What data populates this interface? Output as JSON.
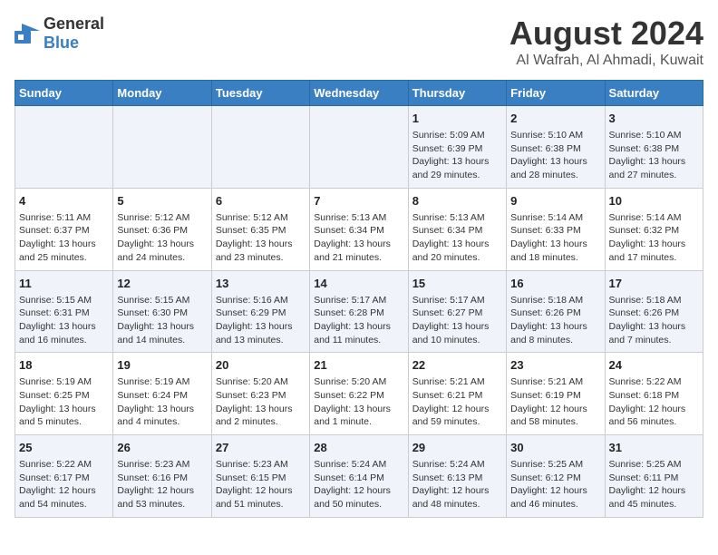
{
  "logo": {
    "general": "General",
    "blue": "Blue"
  },
  "title": "August 2024",
  "subtitle": "Al Wafrah, Al Ahmadi, Kuwait",
  "days_of_week": [
    "Sunday",
    "Monday",
    "Tuesday",
    "Wednesday",
    "Thursday",
    "Friday",
    "Saturday"
  ],
  "weeks": [
    [
      {
        "num": "",
        "content": ""
      },
      {
        "num": "",
        "content": ""
      },
      {
        "num": "",
        "content": ""
      },
      {
        "num": "",
        "content": ""
      },
      {
        "num": "1",
        "content": "Sunrise: 5:09 AM\nSunset: 6:39 PM\nDaylight: 13 hours\nand 29 minutes."
      },
      {
        "num": "2",
        "content": "Sunrise: 5:10 AM\nSunset: 6:38 PM\nDaylight: 13 hours\nand 28 minutes."
      },
      {
        "num": "3",
        "content": "Sunrise: 5:10 AM\nSunset: 6:38 PM\nDaylight: 13 hours\nand 27 minutes."
      }
    ],
    [
      {
        "num": "4",
        "content": "Sunrise: 5:11 AM\nSunset: 6:37 PM\nDaylight: 13 hours\nand 25 minutes."
      },
      {
        "num": "5",
        "content": "Sunrise: 5:12 AM\nSunset: 6:36 PM\nDaylight: 13 hours\nand 24 minutes."
      },
      {
        "num": "6",
        "content": "Sunrise: 5:12 AM\nSunset: 6:35 PM\nDaylight: 13 hours\nand 23 minutes."
      },
      {
        "num": "7",
        "content": "Sunrise: 5:13 AM\nSunset: 6:34 PM\nDaylight: 13 hours\nand 21 minutes."
      },
      {
        "num": "8",
        "content": "Sunrise: 5:13 AM\nSunset: 6:34 PM\nDaylight: 13 hours\nand 20 minutes."
      },
      {
        "num": "9",
        "content": "Sunrise: 5:14 AM\nSunset: 6:33 PM\nDaylight: 13 hours\nand 18 minutes."
      },
      {
        "num": "10",
        "content": "Sunrise: 5:14 AM\nSunset: 6:32 PM\nDaylight: 13 hours\nand 17 minutes."
      }
    ],
    [
      {
        "num": "11",
        "content": "Sunrise: 5:15 AM\nSunset: 6:31 PM\nDaylight: 13 hours\nand 16 minutes."
      },
      {
        "num": "12",
        "content": "Sunrise: 5:15 AM\nSunset: 6:30 PM\nDaylight: 13 hours\nand 14 minutes."
      },
      {
        "num": "13",
        "content": "Sunrise: 5:16 AM\nSunset: 6:29 PM\nDaylight: 13 hours\nand 13 minutes."
      },
      {
        "num": "14",
        "content": "Sunrise: 5:17 AM\nSunset: 6:28 PM\nDaylight: 13 hours\nand 11 minutes."
      },
      {
        "num": "15",
        "content": "Sunrise: 5:17 AM\nSunset: 6:27 PM\nDaylight: 13 hours\nand 10 minutes."
      },
      {
        "num": "16",
        "content": "Sunrise: 5:18 AM\nSunset: 6:26 PM\nDaylight: 13 hours\nand 8 minutes."
      },
      {
        "num": "17",
        "content": "Sunrise: 5:18 AM\nSunset: 6:26 PM\nDaylight: 13 hours\nand 7 minutes."
      }
    ],
    [
      {
        "num": "18",
        "content": "Sunrise: 5:19 AM\nSunset: 6:25 PM\nDaylight: 13 hours\nand 5 minutes."
      },
      {
        "num": "19",
        "content": "Sunrise: 5:19 AM\nSunset: 6:24 PM\nDaylight: 13 hours\nand 4 minutes."
      },
      {
        "num": "20",
        "content": "Sunrise: 5:20 AM\nSunset: 6:23 PM\nDaylight: 13 hours\nand 2 minutes."
      },
      {
        "num": "21",
        "content": "Sunrise: 5:20 AM\nSunset: 6:22 PM\nDaylight: 13 hours\nand 1 minute."
      },
      {
        "num": "22",
        "content": "Sunrise: 5:21 AM\nSunset: 6:21 PM\nDaylight: 12 hours\nand 59 minutes."
      },
      {
        "num": "23",
        "content": "Sunrise: 5:21 AM\nSunset: 6:19 PM\nDaylight: 12 hours\nand 58 minutes."
      },
      {
        "num": "24",
        "content": "Sunrise: 5:22 AM\nSunset: 6:18 PM\nDaylight: 12 hours\nand 56 minutes."
      }
    ],
    [
      {
        "num": "25",
        "content": "Sunrise: 5:22 AM\nSunset: 6:17 PM\nDaylight: 12 hours\nand 54 minutes."
      },
      {
        "num": "26",
        "content": "Sunrise: 5:23 AM\nSunset: 6:16 PM\nDaylight: 12 hours\nand 53 minutes."
      },
      {
        "num": "27",
        "content": "Sunrise: 5:23 AM\nSunset: 6:15 PM\nDaylight: 12 hours\nand 51 minutes."
      },
      {
        "num": "28",
        "content": "Sunrise: 5:24 AM\nSunset: 6:14 PM\nDaylight: 12 hours\nand 50 minutes."
      },
      {
        "num": "29",
        "content": "Sunrise: 5:24 AM\nSunset: 6:13 PM\nDaylight: 12 hours\nand 48 minutes."
      },
      {
        "num": "30",
        "content": "Sunrise: 5:25 AM\nSunset: 6:12 PM\nDaylight: 12 hours\nand 46 minutes."
      },
      {
        "num": "31",
        "content": "Sunrise: 5:25 AM\nSunset: 6:11 PM\nDaylight: 12 hours\nand 45 minutes."
      }
    ]
  ]
}
